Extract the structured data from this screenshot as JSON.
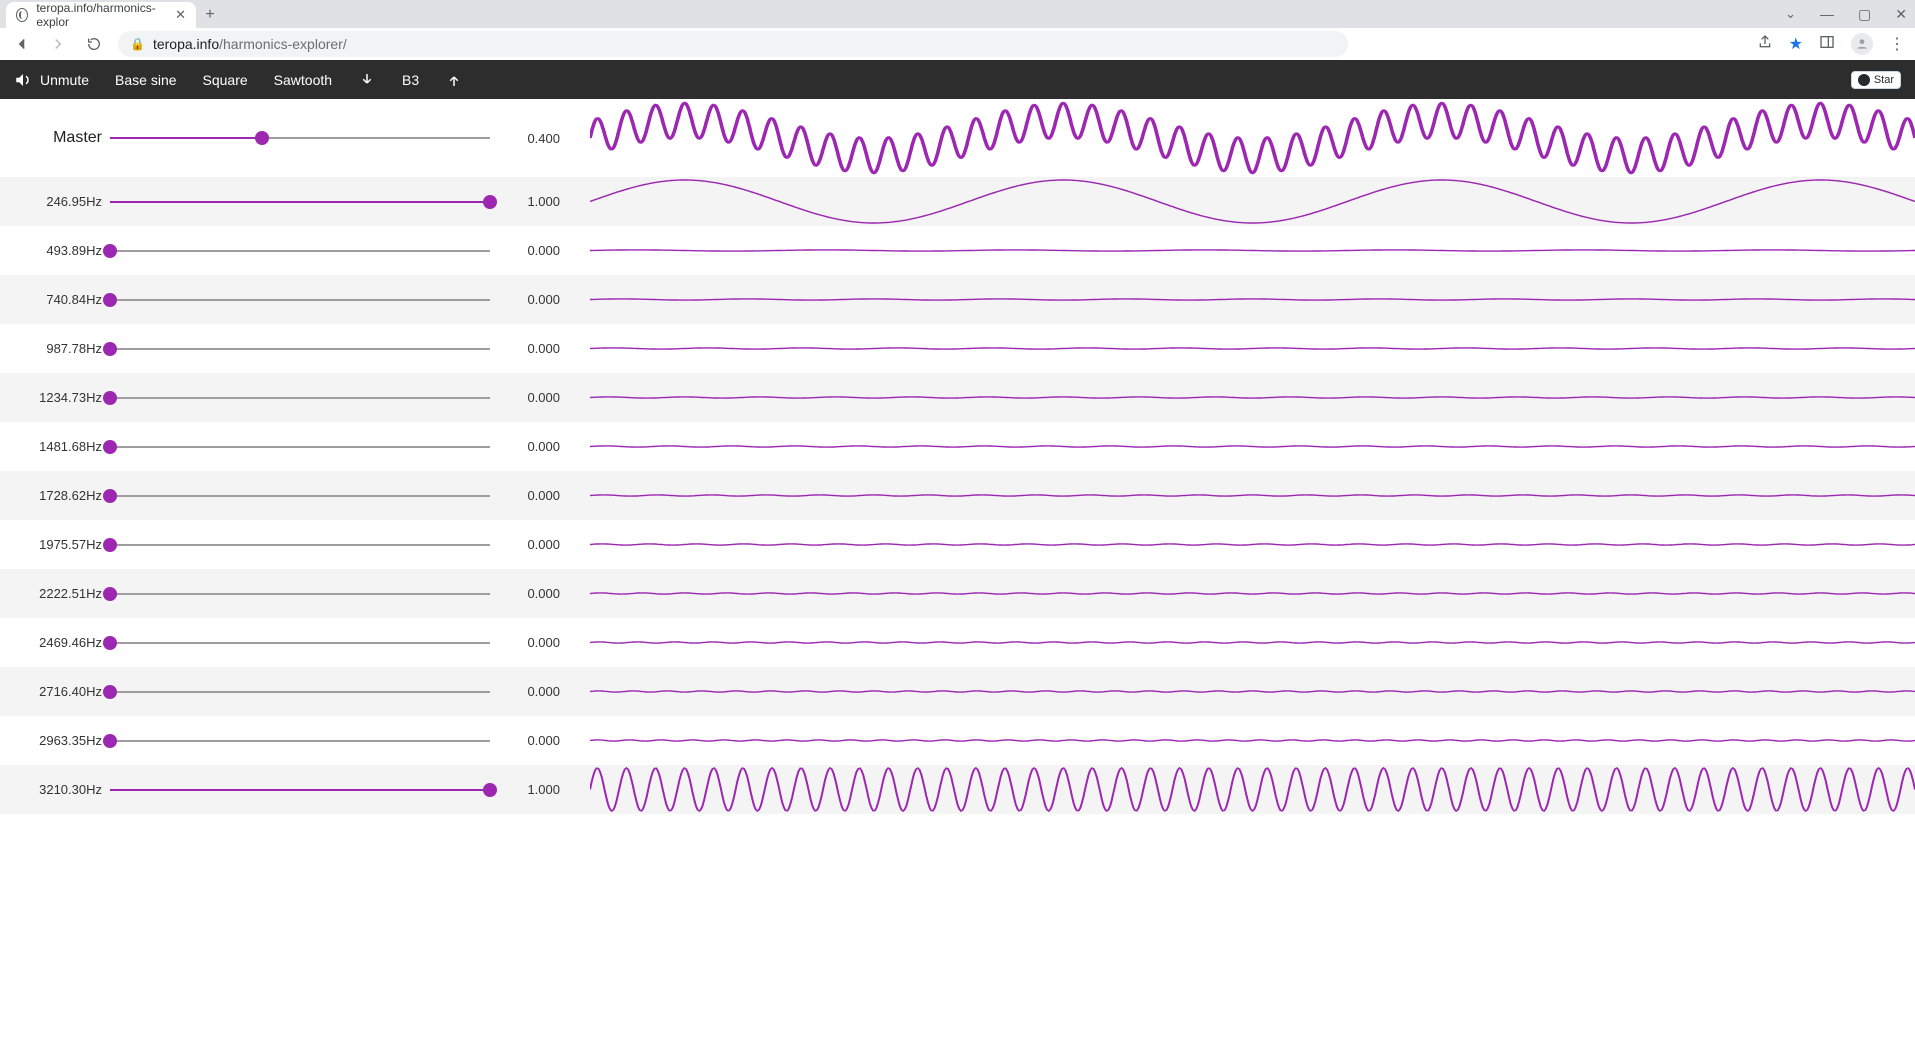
{
  "browser": {
    "tab_title": "teropa.info/harmonics-explor",
    "url_domain": "teropa.info",
    "url_path": "/harmonics-explorer/"
  },
  "appbar": {
    "unmute": "Unmute",
    "base_sine": "Base sine",
    "square": "Square",
    "sawtooth": "Sawtooth",
    "note": "B3",
    "github_star": "Star"
  },
  "accent_color": "#9c27b0",
  "master": {
    "label": "Master",
    "value": 0.4,
    "value_str": "0.400"
  },
  "partials": [
    {
      "freq": "246.95Hz",
      "value": 1.0,
      "value_str": "1.000"
    },
    {
      "freq": "493.89Hz",
      "value": 0.0,
      "value_str": "0.000"
    },
    {
      "freq": "740.84Hz",
      "value": 0.0,
      "value_str": "0.000"
    },
    {
      "freq": "987.78Hz",
      "value": 0.0,
      "value_str": "0.000"
    },
    {
      "freq": "1234.73Hz",
      "value": 0.0,
      "value_str": "0.000"
    },
    {
      "freq": "1481.68Hz",
      "value": 0.0,
      "value_str": "0.000"
    },
    {
      "freq": "1728.62Hz",
      "value": 0.0,
      "value_str": "0.000"
    },
    {
      "freq": "1975.57Hz",
      "value": 0.0,
      "value_str": "0.000"
    },
    {
      "freq": "2222.51Hz",
      "value": 0.0,
      "value_str": "0.000"
    },
    {
      "freq": "2469.46Hz",
      "value": 0.0,
      "value_str": "0.000"
    },
    {
      "freq": "2716.40Hz",
      "value": 0.0,
      "value_str": "0.000"
    },
    {
      "freq": "2963.35Hz",
      "value": 0.0,
      "value_str": "0.000"
    },
    {
      "freq": "3210.30Hz",
      "value": 1.0,
      "value_str": "1.000"
    }
  ]
}
